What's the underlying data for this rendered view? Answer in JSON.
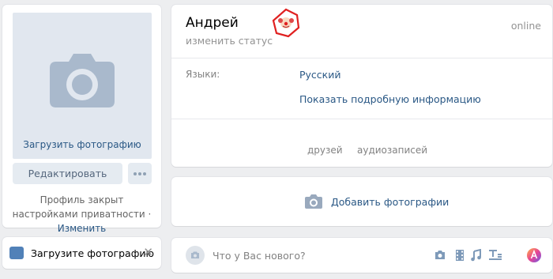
{
  "profile": {
    "upload_photo_label": "Загрузить фотографию",
    "edit_button": "Редактировать",
    "privacy_text": "Профиль закрыт настройками приватности ·",
    "privacy_link": "Изменить"
  },
  "reminder": {
    "label": "Загрузите фотографию",
    "close": "✕"
  },
  "header": {
    "name": "Андрей",
    "status": "изменить статус",
    "online": "online"
  },
  "info": {
    "languages_label": "Языки:",
    "languages_value": "Русский",
    "more_info": "Показать подробную информацию"
  },
  "counters": {
    "friends": "друзей",
    "audio": "аудиозаписей"
  },
  "photos": {
    "add": "Добавить фотографии"
  },
  "post": {
    "placeholder": "Что у Вас нового?"
  },
  "colors": {
    "link": "#2a5885",
    "accent": "#5181b8",
    "background": "#edeef0"
  }
}
